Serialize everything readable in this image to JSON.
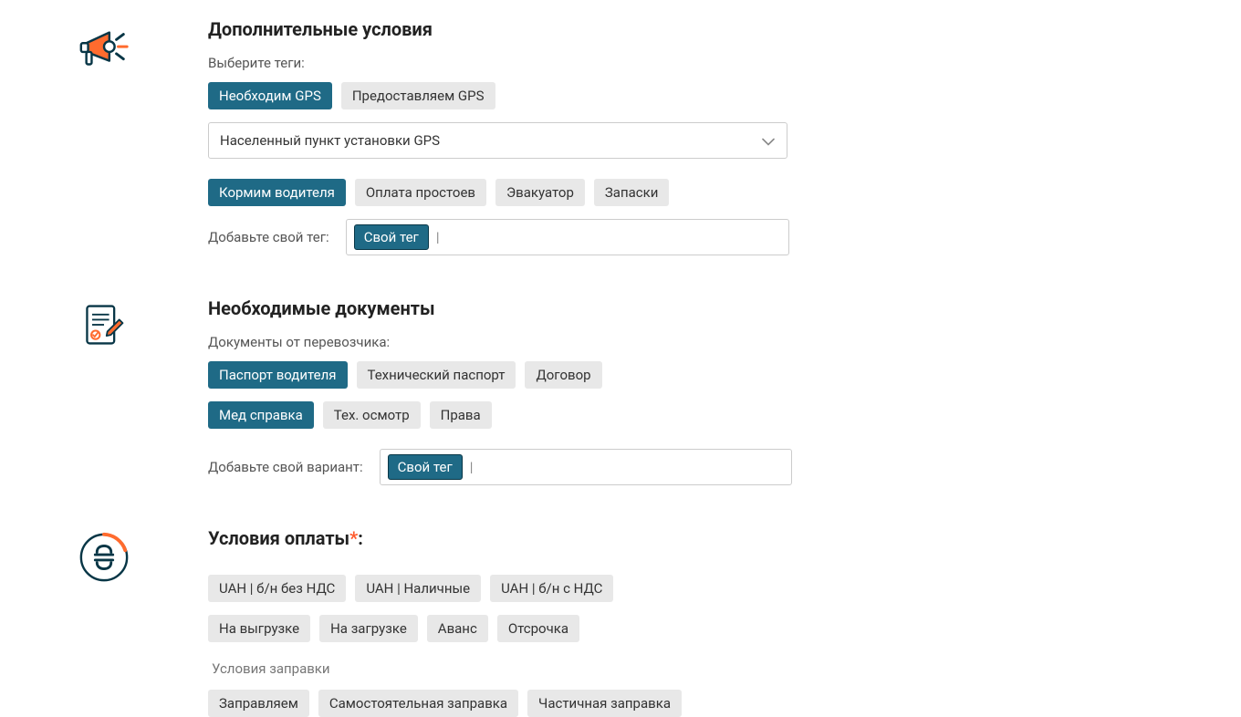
{
  "additional": {
    "title": "Дополнительные условия",
    "choose_tags": "Выберите теги:",
    "gps_tags": [
      "Необходим GPS",
      "Предоставляем GPS"
    ],
    "gps_place_placeholder": "Населенный пункт установки GPS",
    "tags2": [
      "Кормим водителя",
      "Оплата простоев",
      "Эвакуатор",
      "Запаски"
    ],
    "custom_label": "Добавьте свой тег:",
    "custom_chip": "Свой тег",
    "cursor": "|"
  },
  "documents": {
    "title": "Необходимые документы",
    "sub": "Документы от перевозчика:",
    "tags1": [
      "Паспорт водителя",
      "Технический паспорт",
      "Договор"
    ],
    "tags2": [
      "Мед справка",
      "Тех. осмотр",
      "Права"
    ],
    "custom_label": "Добавьте свой вариант:",
    "custom_chip": "Свой тег",
    "cursor": "|"
  },
  "payment": {
    "title_prefix": "Условия оплаты",
    "title_suffix": ":",
    "tags1": [
      "UAH | б/н без НДС",
      "UAH | Наличные",
      "UAH | б/н с НДС"
    ],
    "tags2": [
      "На выгрузке",
      "На загрузке",
      "Аванс",
      "Отсрочка"
    ],
    "fuel_label": "Условия заправки",
    "tags3": [
      "Заправляем",
      "Самостоятельная заправка",
      "Частичная заправка"
    ]
  },
  "colors": {
    "teal": "#1f6a86",
    "grey_tag": "#e8e8e8",
    "orange": "#ff6b2e"
  }
}
